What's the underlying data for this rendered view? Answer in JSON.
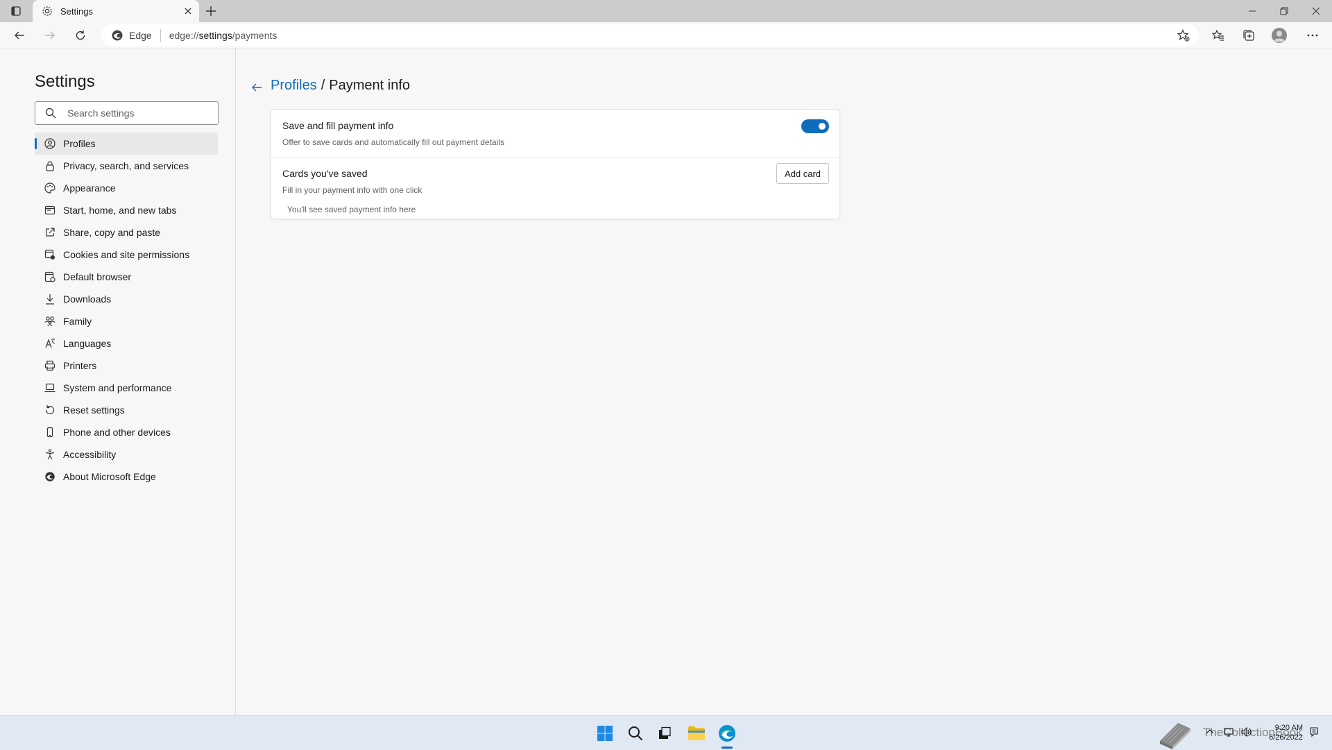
{
  "browser": {
    "tab_title": "Settings",
    "address_site": "Edge",
    "address_url_prefix": "edge://",
    "address_url_path": "settings",
    "address_url_rest": "/payments"
  },
  "sidebar": {
    "title": "Settings",
    "search_placeholder": "Search settings",
    "items": [
      {
        "label": "Profiles",
        "icon": "profile-icon",
        "active": true
      },
      {
        "label": "Privacy, search, and services",
        "icon": "lock-icon"
      },
      {
        "label": "Appearance",
        "icon": "appearance-icon"
      },
      {
        "label": "Start, home, and new tabs",
        "icon": "start-tabs-icon"
      },
      {
        "label": "Share, copy and paste",
        "icon": "share-icon"
      },
      {
        "label": "Cookies and site permissions",
        "icon": "cookies-icon"
      },
      {
        "label": "Default browser",
        "icon": "default-browser-icon"
      },
      {
        "label": "Downloads",
        "icon": "download-icon"
      },
      {
        "label": "Family",
        "icon": "family-icon"
      },
      {
        "label": "Languages",
        "icon": "languages-icon"
      },
      {
        "label": "Printers",
        "icon": "printer-icon"
      },
      {
        "label": "System and performance",
        "icon": "system-icon"
      },
      {
        "label": "Reset settings",
        "icon": "reset-icon"
      },
      {
        "label": "Phone and other devices",
        "icon": "phone-icon"
      },
      {
        "label": "Accessibility",
        "icon": "accessibility-icon"
      },
      {
        "label": "About Microsoft Edge",
        "icon": "edge-logo-icon"
      }
    ]
  },
  "main": {
    "breadcrumb_parent": "Profiles",
    "breadcrumb_separator": "/",
    "breadcrumb_current": "Payment info",
    "save_fill": {
      "title": "Save and fill payment info",
      "description": "Offer to save cards and automatically fill out payment details",
      "enabled": true
    },
    "cards": {
      "title": "Cards you've saved",
      "description": "Fill in your payment info with one click",
      "add_button": "Add card",
      "empty_text": "You'll see saved payment info here"
    }
  },
  "taskbar": {
    "watermark": "TheCollectionBook",
    "time": "9:20 AM",
    "date": "6/26/2022"
  },
  "colors": {
    "accent": "#0f6cbd",
    "taskbar": "#dfe8f3",
    "titlebar": "#cccccc"
  }
}
